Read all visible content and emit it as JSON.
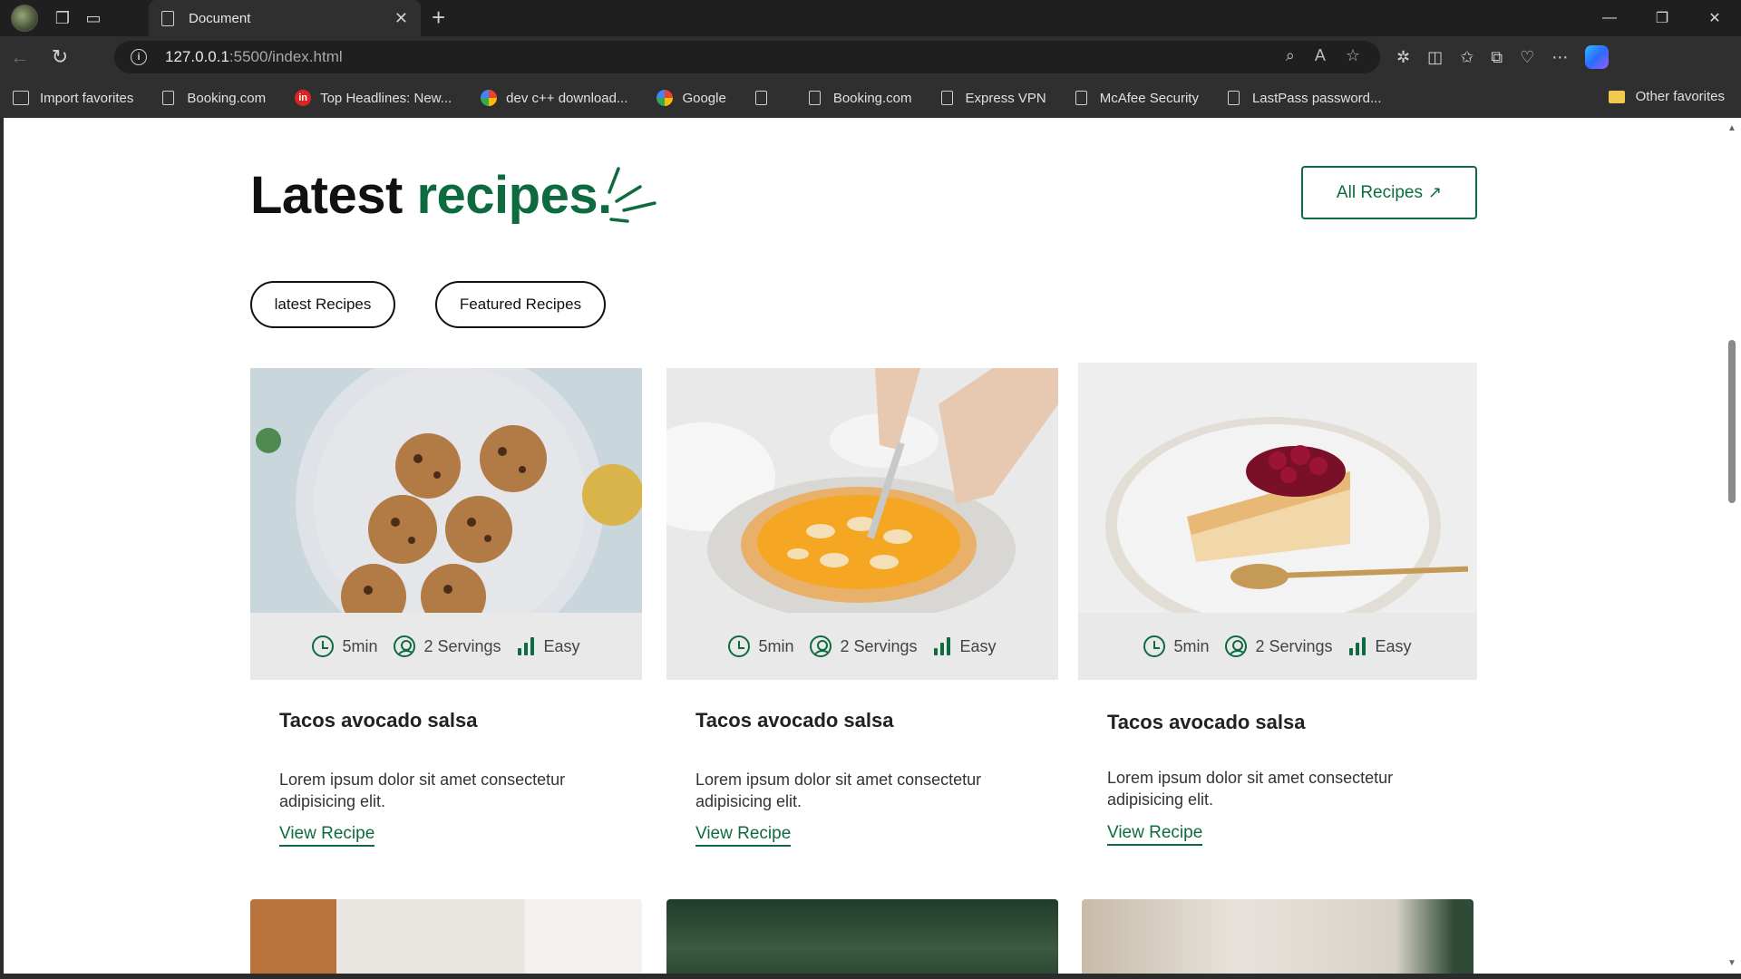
{
  "browser": {
    "tab_title": "Document",
    "address_host": "127.0.0.1",
    "address_path": ":5500/index.html",
    "bookmarks": [
      {
        "label": "Import favorites",
        "icon": "import-icon"
      },
      {
        "label": "Booking.com",
        "icon": "page-icon"
      },
      {
        "label": "Top Headlines: New...",
        "icon": "news-icon"
      },
      {
        "label": "dev c++ download...",
        "icon": "google-icon"
      },
      {
        "label": "Google",
        "icon": "google-icon"
      },
      {
        "label": "",
        "icon": "page-icon"
      },
      {
        "label": "Booking.com",
        "icon": "page-icon"
      },
      {
        "label": "Express VPN",
        "icon": "page-icon"
      },
      {
        "label": "McAfee Security",
        "icon": "page-icon"
      },
      {
        "label": "LastPass password...",
        "icon": "page-icon"
      }
    ],
    "other_favorites": "Other favorites"
  },
  "page": {
    "heading_main": "Latest ",
    "heading_accent": "recipes.",
    "all_recipes_label": "All Recipes",
    "filters": [
      "latest Recipes",
      "Featured Recipes"
    ],
    "accent_color": "#0e6b3f",
    "cards": [
      {
        "image": "cookies-on-plate",
        "time": "5min",
        "servings": "2 Servings",
        "difficulty": "Easy",
        "title": "Tacos avocado salsa",
        "description": "Lorem ipsum dolor sit amet consectetur adipisicing elit.",
        "link": "View Recipe"
      },
      {
        "image": "pie-being-cut",
        "time": "5min",
        "servings": "2 Servings",
        "difficulty": "Easy",
        "title": "Tacos avocado salsa",
        "description": "Lorem ipsum dolor sit amet consectetur adipisicing elit.",
        "link": "View Recipe"
      },
      {
        "image": "cheesecake-slice",
        "time": "5min",
        "servings": "2 Servings",
        "difficulty": "Easy",
        "title": "Tacos avocado salsa",
        "description": "Lorem ipsum dolor sit amet consectetur adipisicing elit.",
        "link": "View Recipe"
      }
    ]
  }
}
